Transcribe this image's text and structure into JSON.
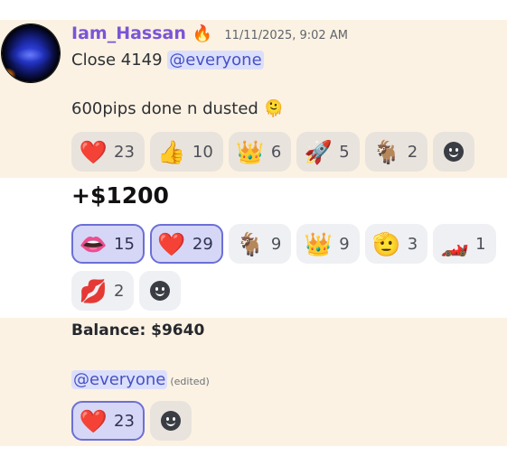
{
  "message1": {
    "username": "Iam_Hassan",
    "badge_icon": "fire-icon",
    "timestamp": "11/11/2025, 9:02 AM",
    "line1_text": "Close 4149 ",
    "line1_mention": "@everyone",
    "line2_text": "600pips done n dusted",
    "line2_emoji": "🫠",
    "reactions": [
      {
        "emoji": "❤️",
        "name": "heart",
        "count": "23"
      },
      {
        "emoji": "👍",
        "name": "thumbs-up",
        "count": "10"
      },
      {
        "emoji": "👑",
        "name": "crown",
        "count": "6"
      },
      {
        "emoji": "🚀",
        "name": "rocket",
        "count": "5"
      },
      {
        "emoji": "🐐",
        "name": "goat",
        "count": "2"
      }
    ]
  },
  "message2": {
    "text": "+$1200",
    "reactions": [
      {
        "emoji": "👄",
        "name": "lips",
        "count": "15",
        "active": true
      },
      {
        "emoji": "❤️",
        "name": "heart",
        "count": "29",
        "active": true
      },
      {
        "emoji": "🐐",
        "name": "goat",
        "count": "9"
      },
      {
        "emoji": "👑",
        "name": "crown",
        "count": "9"
      },
      {
        "emoji": "🫡",
        "name": "salute",
        "count": "3"
      },
      {
        "emoji": "🏎️",
        "name": "race-car",
        "count": "1"
      },
      {
        "emoji": "💋",
        "name": "kiss",
        "count": "2"
      }
    ]
  },
  "message3": {
    "balance_label": "Balance: $9640",
    "mention": "@everyone",
    "edited": "(edited)",
    "reactions": [
      {
        "emoji": "❤️",
        "name": "heart",
        "count": "23",
        "active": true
      }
    ]
  }
}
